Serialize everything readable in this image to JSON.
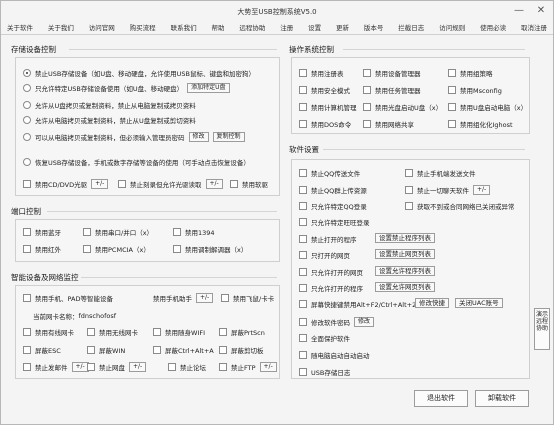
{
  "window": {
    "title": "大势至USB控制系统V5.0",
    "min": "—",
    "close": "✕"
  },
  "menu": [
    "关于软件",
    "关于我们",
    "访问官网",
    "购买流程",
    "联系我们",
    "帮助",
    "远程协助",
    "注册",
    "设置",
    "更新",
    "版本号",
    "拦截日志",
    "访问规则",
    "使用必读",
    "取消注册"
  ],
  "storage": {
    "title": "存储设备控制",
    "radios": [
      "禁止USB存储设备（如U盘、移动硬盘，允许使用USB鼠标、键盘和加密狗）",
      "只允许特定USB存储设备使用（如U盘、移动硬盘）",
      "允许从U盘拷贝或复制资料，禁止从电脑复制或拷贝资料",
      "允许从电脑拷贝或复制资料，禁止从U盘复制或剪切资料",
      "可以从电脑拷贝或复制资料，但必须输入管理员密码",
      "恢复USB存储设备，手机或数字存储等设备的使用（可手动点击恢复设备）"
    ],
    "selected": 0,
    "add_specific_btn": "添加特定U盘",
    "modify_btn": "修改",
    "copy_ctrl_btn": "复制控制",
    "checks": [
      "禁用CD/DVD光驱",
      "禁止刻录但允许光驱读取",
      "禁用软驱"
    ],
    "more_btn": "+/-"
  },
  "ports": {
    "title": "端口控制",
    "items": [
      {
        "label": "禁用蓝牙",
        "state": ""
      },
      {
        "label": "禁用串口/并口",
        "state": "（x）"
      },
      {
        "label": "禁用1394",
        "state": ""
      },
      {
        "label": "禁用红外",
        "state": ""
      },
      {
        "label": "禁用PCMCIA",
        "state": "（x）"
      },
      {
        "label": "禁用调制解调器",
        "state": "（x）"
      }
    ]
  },
  "peripherals": {
    "title": "智能设备及网络监控",
    "phone": "禁用手机、PAD等智能设备",
    "phone_allow": "禁用手机助手",
    "phone_tether": "禁用飞鼠/卡卡",
    "current_adapter_label": "当前网卡名称：",
    "current_adapter": "fdnschofosf",
    "checks_row1": [
      "禁用有线网卡",
      "禁用无线网卡",
      "禁用随身WIFI",
      "屏蔽PrtScn"
    ],
    "checks_row2": [
      "屏蔽ESC",
      "屏蔽WIN",
      "屏蔽Ctrl+Alt+A",
      "屏蔽剪切板"
    ],
    "checks_row3": [
      "禁止发邮件",
      "禁止网盘",
      "禁止论坛",
      "禁止FTP"
    ],
    "more_btn": "+/-"
  },
  "os": {
    "title": "操作系统控制",
    "items": [
      [
        "禁用注册表",
        "禁用设备管理器",
        "禁用组策略"
      ],
      [
        "禁用安全模式",
        "禁用任务管理器",
        "禁用Msconfig"
      ],
      [
        "禁用计算机管理",
        "禁用光盘启动U盘（x）",
        "禁用U盘启动电脑（x）"
      ],
      [
        "禁用DOS命令",
        "禁用网络共享",
        "禁用组化化Ighost"
      ]
    ]
  },
  "software": {
    "title": "软件设置",
    "col1": [
      "禁止QQ传送文件",
      "禁止QQ群上传资源",
      "只允许特定QQ登录",
      "只允许特定旺旺登录",
      "禁止打开的程序",
      "只打开的网页",
      "只允许打开的网页",
      "只允许打开的程序",
      "只允许打开的网页"
    ],
    "col2": [
      "禁止手机端发送文件",
      "禁止一切聊天软件",
      "获取不到或合同网络已关闭或异常"
    ],
    "btns": [
      "设置禁止程序列表",
      "设置禁止网页列表",
      "设置允许程序列表",
      "设置允许网页列表",
      "设置禁止网页列表"
    ],
    "shortcut": "屏幕快捷键禁用Alt+F2/Ctrl+Alt+2",
    "modify_shortcut": "修改快捷",
    "close_uac": "关闭UAC账号",
    "modify_pwd": "修改软件密码",
    "modify": "修改",
    "others": [
      "全面保护软件",
      "随电脑启动自动启动",
      "USB存储日志"
    ],
    "more_btn": "+/-"
  },
  "footer": {
    "exit": "退出软件",
    "uninstall": "卸载软件"
  },
  "sidetab": "演示远程协助"
}
